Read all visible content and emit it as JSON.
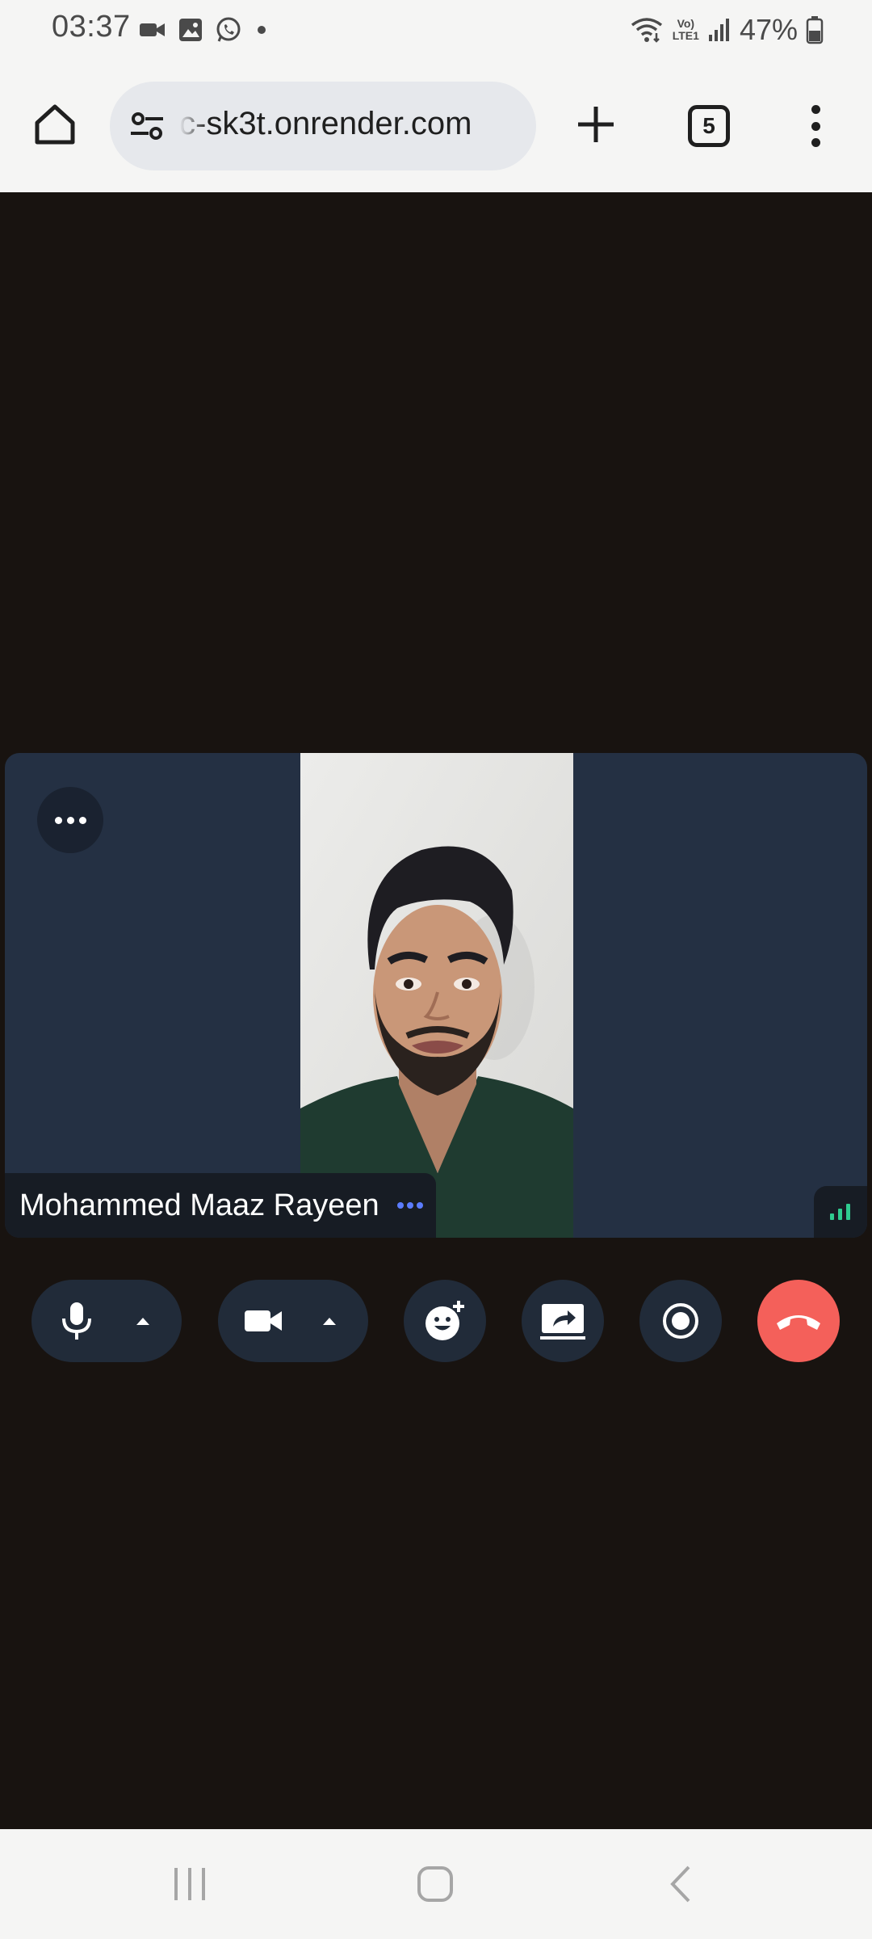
{
  "status_bar": {
    "time": "03:37",
    "notification_icons": [
      "video-call-icon",
      "gallery-icon",
      "whatsapp-icon",
      "dot-icon"
    ],
    "network": "VoLTE1",
    "battery": "47%"
  },
  "browser": {
    "url": "c-sk3t.onrender.com",
    "tab_count": "5"
  },
  "call": {
    "participant_name": "Mohammed Maaz Rayeen",
    "colors": {
      "tile_bg": "#243043",
      "hangup": "#f4605a",
      "signal": "#2fcb8f",
      "name_dots": "#5b7cff"
    }
  },
  "controls": {
    "buttons": [
      "microphone",
      "camera",
      "reactions",
      "share-screen",
      "record",
      "leave-call"
    ]
  }
}
